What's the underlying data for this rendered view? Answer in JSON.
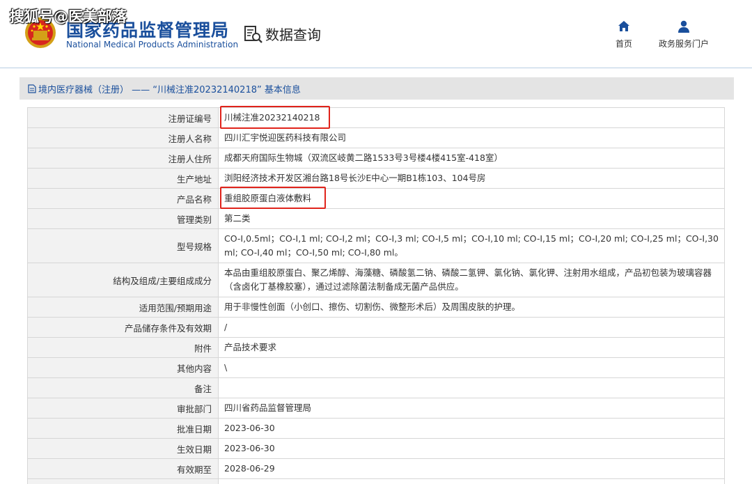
{
  "watermark": "搜狐号@医美部落",
  "header": {
    "brand_cn": "国家药品监督管理局",
    "brand_en": "National Medical Products Administration",
    "query_label": "数据查询",
    "nav": {
      "home": "首页",
      "portal": "政务服务门户"
    }
  },
  "breadcrumb": "境内医疗器械（注册） —— “川械注准20232140218” 基本信息",
  "colors": {
    "brand": "#1a4f9c",
    "highlight": "#e0231b"
  },
  "rows": [
    {
      "label": "注册证编号",
      "value": "川械注准20232140218"
    },
    {
      "label": "注册人名称",
      "value": "四川汇宇悦迎医药科技有限公司"
    },
    {
      "label": "注册人住所",
      "value": "成都天府国际生物城（双流区岐黄二路1533号3号楼4楼415室-418室）"
    },
    {
      "label": "生产地址",
      "value": "浏阳经济技术开发区湘台路18号长沙E中心一期B1栋103、104号房"
    },
    {
      "label": "产品名称",
      "value": "重组胶原蛋白液体敷料"
    },
    {
      "label": "管理类别",
      "value": "第二类"
    },
    {
      "label": "型号规格",
      "value": "CO-Ⅰ,0.5ml；CO-Ⅰ,1 ml; CO-Ⅰ,2 ml；CO-Ⅰ,3 ml; CO-Ⅰ,5 ml；CO-Ⅰ,10 ml; CO-Ⅰ,15 ml；CO-Ⅰ,20 ml; CO-Ⅰ,25 ml；CO-Ⅰ,30 ml; CO-Ⅰ,40 ml；CO-Ⅰ,50 ml; CO-Ⅰ,80 ml。"
    },
    {
      "label": "结构及组成/主要组成成分",
      "value": "本品由重组胶原蛋白、聚乙烯醇、海藻糖、磷酸氢二钠、磷酸二氢钾、氯化钠、氯化钾、注射用水组成，产品初包装为玻璃容器（含卤化丁基橡胶塞），通过过滤除菌法制备成无菌产品供应。"
    },
    {
      "label": "适用范围/预期用途",
      "value": "用于非慢性创面（小创口、擦伤、切割伤、微整形术后）及周围皮肤的护理。"
    },
    {
      "label": "产品储存条件及有效期",
      "value": "/"
    },
    {
      "label": "附件",
      "value": "产品技术要求"
    },
    {
      "label": "其他内容",
      "value": "\\"
    },
    {
      "label": "备注",
      "value": ""
    },
    {
      "label": "审批部门",
      "value": "四川省药品监督管理局"
    },
    {
      "label": "批准日期",
      "value": "2023-06-30"
    },
    {
      "label": "生效日期",
      "value": "2023-06-30"
    },
    {
      "label": "有效期至",
      "value": "2028-06-29"
    },
    {
      "label": "",
      "value": ""
    }
  ]
}
